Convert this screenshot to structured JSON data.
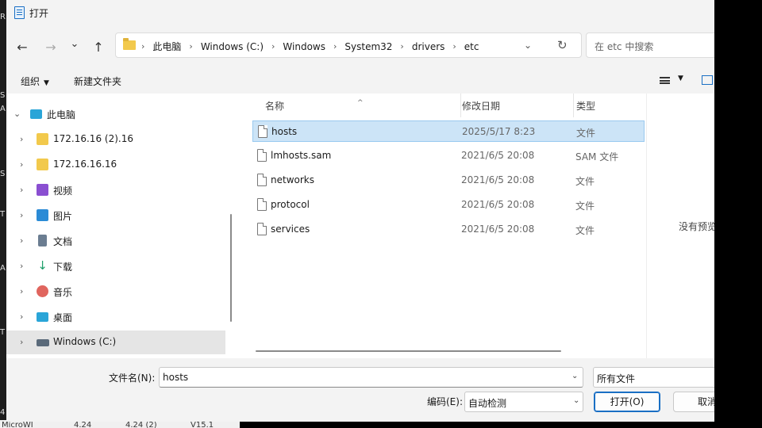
{
  "window": {
    "title": "打开"
  },
  "nav": {
    "back_glyph": "←",
    "forward_glyph": "→",
    "recent_glyph": "⌄",
    "up_glyph": "↑"
  },
  "address": {
    "segments": [
      "此电脑",
      "Windows (C:)",
      "Windows",
      "System32",
      "drivers",
      "etc"
    ],
    "separator": "›",
    "dropdown_glyph": "⌄",
    "refresh_glyph": "↻"
  },
  "search": {
    "placeholder": "在 etc 中搜索"
  },
  "toolbar": {
    "organize": "组织",
    "new_folder": "新建文件夹",
    "caret": "▼"
  },
  "tree": {
    "chevron_collapsed": "›",
    "chevron_expanded": "⌄",
    "root": {
      "label": "此电脑",
      "icon": "computer-icon"
    },
    "items": [
      {
        "label": "172.16.16 (2).16",
        "icon": "network-drive-icon",
        "color": "#f2c94c"
      },
      {
        "label": "172.16.16.16",
        "icon": "network-drive-icon",
        "color": "#f2c94c"
      },
      {
        "label": "视频",
        "icon": "video-icon",
        "color": "#8a4fd1"
      },
      {
        "label": "图片",
        "icon": "picture-icon",
        "color": "#2b8bd6"
      },
      {
        "label": "文档",
        "icon": "document-icon",
        "color": "#6b7d91"
      },
      {
        "label": "下载",
        "icon": "download-icon",
        "color": "#1e9e6a"
      },
      {
        "label": "音乐",
        "icon": "music-icon",
        "color": "#e0655e"
      },
      {
        "label": "桌面",
        "icon": "desktop-icon",
        "color": "#2aa5d8"
      },
      {
        "label": "Windows (C:)",
        "icon": "drive-icon",
        "color": "#5a6a7a"
      }
    ]
  },
  "columns": {
    "name": "名称",
    "modified": "修改日期",
    "type": "类型",
    "sort_glyph": "^"
  },
  "files": [
    {
      "name": "hosts",
      "modified": "2025/5/17 8:23",
      "type": "文件",
      "selected": true
    },
    {
      "name": "lmhosts.sam",
      "modified": "2021/6/5 20:08",
      "type": "SAM 文件",
      "selected": false
    },
    {
      "name": "networks",
      "modified": "2021/6/5 20:08",
      "type": "文件",
      "selected": false
    },
    {
      "name": "protocol",
      "modified": "2021/6/5 20:08",
      "type": "文件",
      "selected": false
    },
    {
      "name": "services",
      "modified": "2021/6/5 20:08",
      "type": "文件",
      "selected": false
    }
  ],
  "preview": {
    "text": "没有预览"
  },
  "bottom": {
    "filename_label": "文件名(N):",
    "filename_value": "hosts",
    "filter_value": "所有文件",
    "encoding_label": "编码(E):",
    "encoding_value": "自动检测",
    "open_button": "打开(O)",
    "cancel_button": "取消",
    "dropdown_glyph": "⌄"
  },
  "background": {
    "left_chars": [
      "R",
      "S",
      "A",
      "S",
      "T",
      "A",
      "T",
      "4"
    ],
    "bottom_texts": [
      "MicroWI",
      "4.24",
      "4.24 (2)",
      "V15.1"
    ]
  },
  "colors": {
    "selection": "#cce4f7",
    "accent": "#1a6fc4",
    "folder": "#f2c94c"
  }
}
